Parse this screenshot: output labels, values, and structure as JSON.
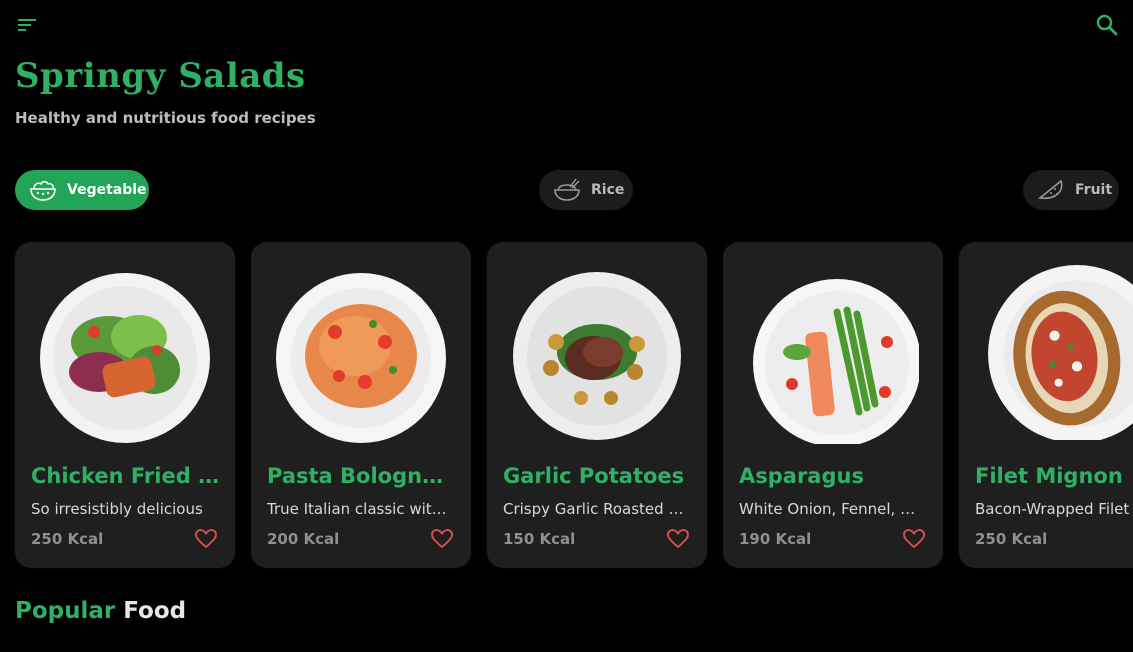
{
  "app": {
    "title": "Springy Salads",
    "subtitle": "Healthy and nutritious food recipes"
  },
  "toolbar": {
    "menu_icon": "menu-icon",
    "search_icon": "search-icon"
  },
  "categories": [
    {
      "label": "Vegetable",
      "icon": "salad-bowl-icon",
      "selected": true
    },
    {
      "label": "Rice",
      "icon": "rice-bowl-icon",
      "selected": false
    },
    {
      "label": "Fruit",
      "icon": "watermelon-icon",
      "selected": false
    }
  ],
  "recipes": [
    {
      "name": "Chicken Fried ...",
      "description": "So irresistibly delicious",
      "kcal": "250 Kcal"
    },
    {
      "name": "Pasta Bolognese",
      "description": "True Italian classic with a meaty sauce",
      "kcal": "200 Kcal"
    },
    {
      "name": "Garlic Potatoes",
      "description": "Crispy Garlic Roasted Potatoes",
      "kcal": "150 Kcal"
    },
    {
      "name": "Asparagus",
      "description": "White Onion, Fennel, and Watercress",
      "kcal": "190 Kcal"
    },
    {
      "name": "Filet Mignon",
      "description": "Bacon-Wrapped Filet Mignon",
      "kcal": "250 Kcal"
    }
  ],
  "section": {
    "word1": "Popular",
    "word2": "Food"
  },
  "colors": {
    "accent": "#2fb164",
    "chip_active": "#23a557",
    "background": "#000000",
    "card": "#1f1f1f",
    "heart": "#e0524f"
  }
}
